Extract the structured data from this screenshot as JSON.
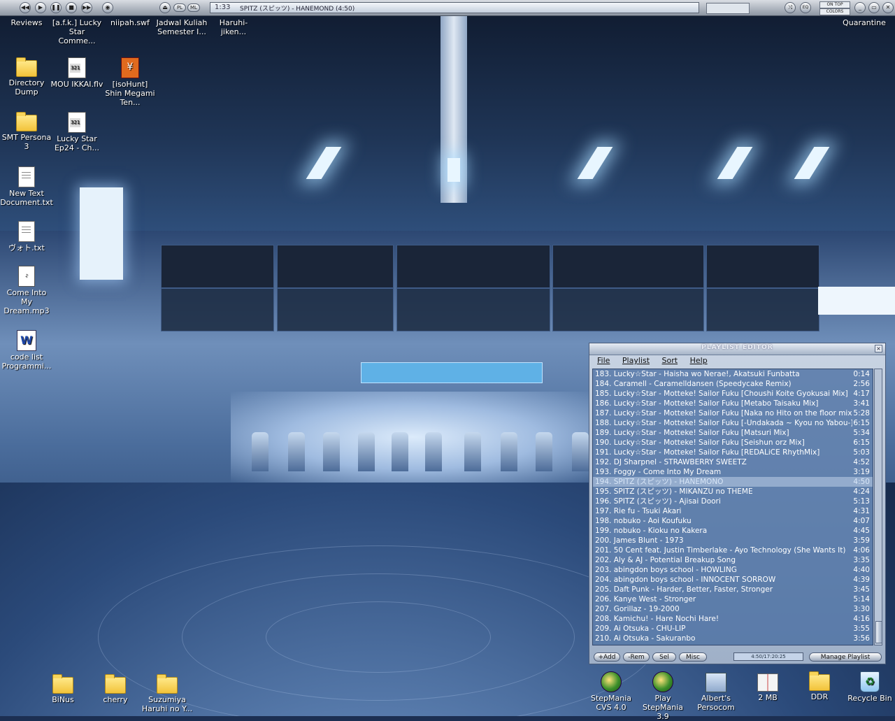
{
  "winamp": {
    "time": "1:33",
    "track_title": "SPITZ (スピッツ) - HANEMOND (4:50)",
    "pl_label": "PL",
    "ml_label": "ML",
    "on_top_label": "ON TOP",
    "colors_label": "COLORS",
    "eq_label": "EQ"
  },
  "desktop_icons": [
    {
      "label": "Reviews",
      "icon": "folder-icon"
    },
    {
      "label": "[a.f.k.] Lucky Star Comme...",
      "icon": "video-file-icon"
    },
    {
      "label": "niipah.swf",
      "icon": "flash-file-icon"
    },
    {
      "label": "Jadwal Kuliah Semester I...",
      "icon": "document-icon"
    },
    {
      "label": "Haruhi-jiken...",
      "icon": "document-icon"
    },
    {
      "label": "Quarantine",
      "icon": "folder-icon"
    },
    {
      "label": "Directory Dump",
      "icon": "folder-icon"
    },
    {
      "label": "MOU IKKAI.flv",
      "icon": "video-file-icon"
    },
    {
      "label": "[isoHunt] Shin Megami Ten...",
      "icon": "torrent-file-icon"
    },
    {
      "label": "SMT Persona 3",
      "icon": "folder-icon"
    },
    {
      "label": "Lucky Star Ep24 - Ch...",
      "icon": "video-file-icon"
    },
    {
      "label": "New Text Document.txt",
      "icon": "text-file-icon"
    },
    {
      "label": "ヴォト.txt",
      "icon": "text-file-icon"
    },
    {
      "label": "Come Into My Dream.mp3",
      "icon": "audio-file-icon"
    },
    {
      "label": "code list Programmi...",
      "icon": "word-document-icon"
    },
    {
      "label": "BiNus",
      "icon": "folder-icon"
    },
    {
      "label": "cherry",
      "icon": "folder-icon"
    },
    {
      "label": "Suzumiya Haruhi no Y...",
      "icon": "folder-icon"
    },
    {
      "label": "StepMania CVS 4.0",
      "icon": "stepmania-icon"
    },
    {
      "label": "Play StepMania 3.9",
      "icon": "stepmania-icon"
    },
    {
      "label": "Albert's Persocom",
      "icon": "my-computer-icon"
    },
    {
      "label": "2 MB",
      "icon": "book-icon"
    },
    {
      "label": "DDR",
      "icon": "folder-icon"
    },
    {
      "label": "Recycle Bin",
      "icon": "recycle-bin-icon"
    }
  ],
  "playlist": {
    "title": "PLAYLIST EDITOR",
    "menu": [
      "File",
      "Playlist",
      "Sort",
      "Help"
    ],
    "selected_index": 11,
    "tracks": [
      {
        "num": "183.",
        "title": "Lucky☆Star - Haisha wo Nerae!, Akatsuki Funbatta",
        "dur": "0:14"
      },
      {
        "num": "184.",
        "title": "Caramell - Caramelldansen (Speedycake Remix)",
        "dur": "2:56"
      },
      {
        "num": "185.",
        "title": "Lucky☆Star - Motteke! Sailor Fuku [Choushi Koite Gyokusai Mix]",
        "dur": "4:17"
      },
      {
        "num": "186.",
        "title": "Lucky☆Star - Motteke! Sailor Fuku [Metabo Taisaku Mix]",
        "dur": "3:41"
      },
      {
        "num": "187.",
        "title": "Lucky☆Star - Motteke! Sailor Fuku [Naka no Hito on the floor mix]",
        "dur": "5:28"
      },
      {
        "num": "188.",
        "title": "Lucky☆Star - Motteke! Sailor Fuku [-Undakada ~ Kyou no Yabou-]",
        "dur": "6:15"
      },
      {
        "num": "189.",
        "title": "Lucky☆Star - Motteke! Sailor Fuku [Matsuri Mix]",
        "dur": "5:34"
      },
      {
        "num": "190.",
        "title": "Lucky☆Star - Motteke! Sailor Fuku [Seishun orz Mix]",
        "dur": "6:15"
      },
      {
        "num": "191.",
        "title": "Lucky☆Star - Motteke! Sailor Fuku [REDALiCE RhythMix]",
        "dur": "5:03"
      },
      {
        "num": "192.",
        "title": "DJ Sharpnel - STRAWBERRY SWEETZ",
        "dur": "4:52"
      },
      {
        "num": "193.",
        "title": "Foggy - Come Into My Dream",
        "dur": "3:19"
      },
      {
        "num": "194.",
        "title": "SPITZ (スピッツ) - HANEMONO",
        "dur": "4:50"
      },
      {
        "num": "195.",
        "title": "SPITZ (スピッツ) - MIKANZU no THEME",
        "dur": "4:24"
      },
      {
        "num": "196.",
        "title": "SPITZ (スピッツ) - Ajisai Doori",
        "dur": "5:13"
      },
      {
        "num": "197.",
        "title": "Rie fu - Tsuki Akari",
        "dur": "4:31"
      },
      {
        "num": "198.",
        "title": "nobuko - Aoi Koufuku",
        "dur": "4:07"
      },
      {
        "num": "199.",
        "title": "nobuko - Kioku no Kakera",
        "dur": "4:45"
      },
      {
        "num": "200.",
        "title": "James Blunt - 1973",
        "dur": "3:59"
      },
      {
        "num": "201.",
        "title": "50 Cent feat. Justin Timberlake - Ayo Technology (She Wants It)",
        "dur": "4:06"
      },
      {
        "num": "202.",
        "title": "Aly & AJ - Potential Breakup Song",
        "dur": "3:35"
      },
      {
        "num": "203.",
        "title": "abingdon boys school - HOWLING",
        "dur": "4:40"
      },
      {
        "num": "204.",
        "title": "abingdon boys school - INNOCENT SORROW",
        "dur": "4:39"
      },
      {
        "num": "205.",
        "title": "Daft Punk - Harder, Better, Faster, Stronger",
        "dur": "3:45"
      },
      {
        "num": "206.",
        "title": "Kanye West - Stronger",
        "dur": "5:14"
      },
      {
        "num": "207.",
        "title": "Gorillaz - 19-2000",
        "dur": "3:30"
      },
      {
        "num": "208.",
        "title": "Kamichu! - Hare Nochi Hare!",
        "dur": "4:16"
      },
      {
        "num": "209.",
        "title": "Ai Otsuka - CHU-LIP",
        "dur": "3:55"
      },
      {
        "num": "210.",
        "title": "Ai Otsuka - Sakuranbo",
        "dur": "3:56"
      }
    ],
    "buttons": {
      "add": "+Add",
      "rem": "-Rem",
      "sel": "Sel",
      "misc": "Misc",
      "manage": "Manage Playlist"
    },
    "counter": "4:50/17:20:25"
  },
  "colors": {
    "playlist_text": "#ffffff",
    "playlist_bg": "#40669c",
    "selected_row": "#d2e1f5"
  }
}
